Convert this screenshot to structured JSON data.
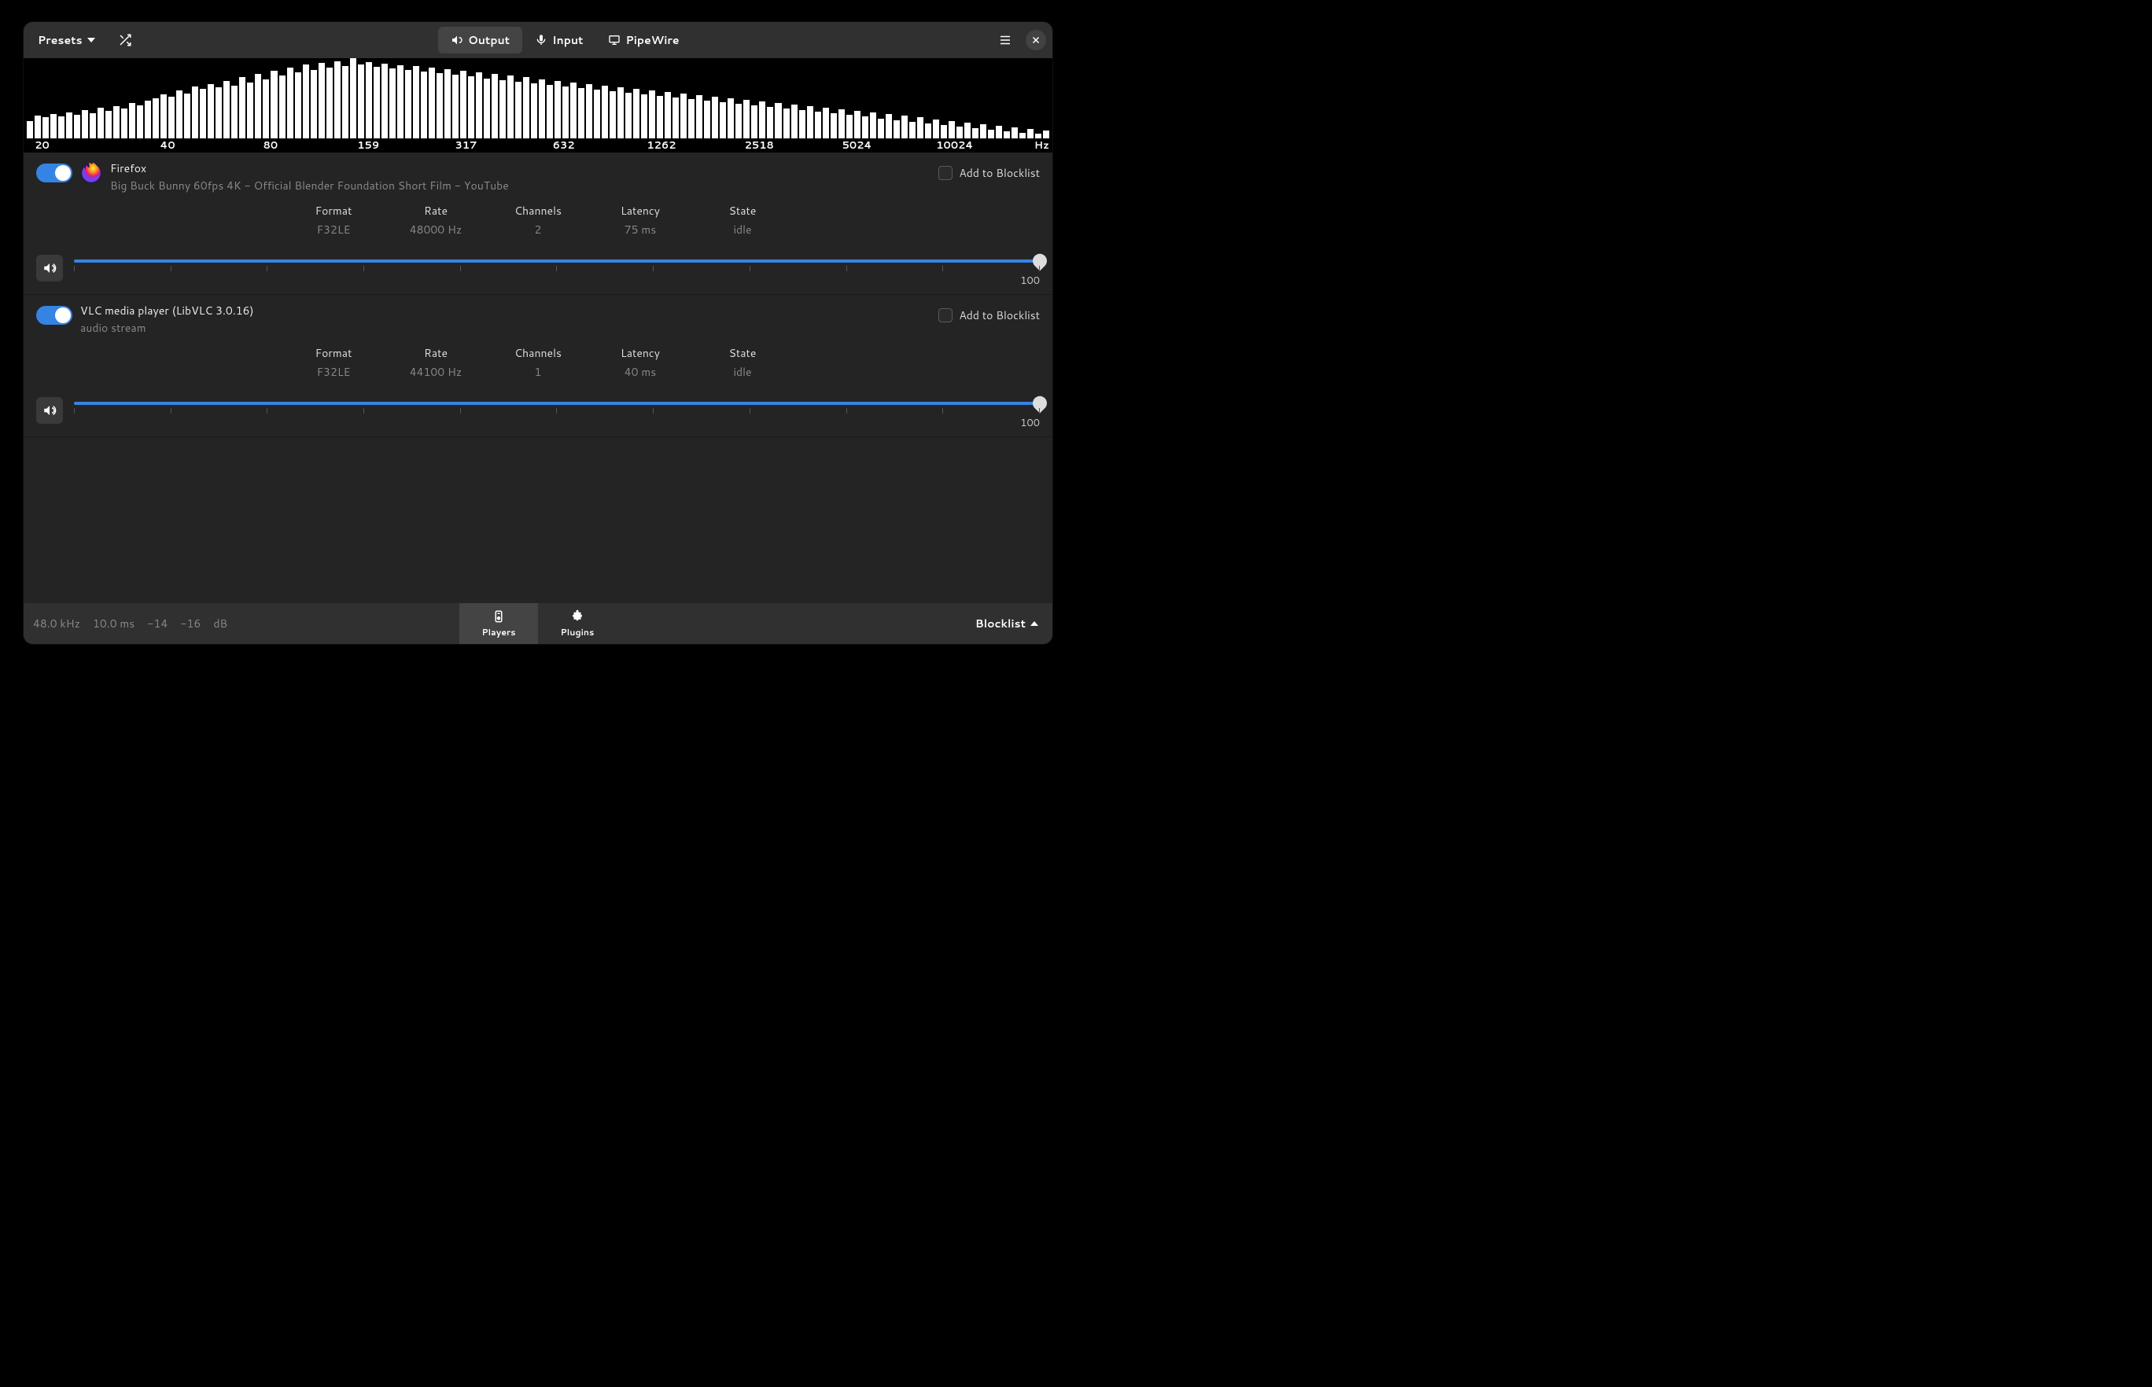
{
  "titlebar": {
    "presets_label": "Presets",
    "tabs": {
      "output": "Output",
      "input": "Input",
      "pipewire": "PipeWire"
    }
  },
  "spectrum": {
    "ticks": [
      "20",
      "40",
      "80",
      "159",
      "317",
      "632",
      "1262",
      "2518",
      "5024",
      "10024"
    ],
    "unit": "Hz"
  },
  "players": [
    {
      "name": "Firefox",
      "subtitle": "Big Buck Bunny 60fps 4K - Official Blender Foundation Short Film - YouTube",
      "enabled": true,
      "blocklist_label": "Add to Blocklist",
      "meta": {
        "format_label": "Format",
        "format_val": "F32LE",
        "rate_label": "Rate",
        "rate_val": "48000 Hz",
        "channels_label": "Channels",
        "channels_val": "2",
        "latency_label": "Latency",
        "latency_val": "75 ms",
        "state_label": "State",
        "state_val": "idle"
      },
      "volume": 100
    },
    {
      "name": "VLC media player (LibVLC 3.0.16)",
      "subtitle": "audio stream",
      "enabled": true,
      "blocklist_label": "Add to Blocklist",
      "meta": {
        "format_label": "Format",
        "format_val": "F32LE",
        "rate_label": "Rate",
        "rate_val": "44100 Hz",
        "channels_label": "Channels",
        "channels_val": "1",
        "latency_label": "Latency",
        "latency_val": "40 ms",
        "state_label": "State",
        "state_val": "idle"
      },
      "volume": 100
    }
  ],
  "statusbar": {
    "rate": "48.0 kHz",
    "latency": "10.0 ms",
    "level_l": "-14",
    "level_r": "-16",
    "db": "dB",
    "nav": {
      "players": "Players",
      "plugins": "Plugins"
    },
    "blocklist": "Blocklist"
  },
  "chart_data": {
    "type": "bar",
    "title": "",
    "xlabel": "Hz",
    "ylabel": "",
    "x_ticks": [
      20,
      40,
      80,
      159,
      317,
      632,
      1262,
      2518,
      5024,
      10024
    ],
    "values": [
      22,
      28,
      26,
      30,
      27,
      32,
      29,
      35,
      31,
      38,
      34,
      40,
      37,
      44,
      41,
      47,
      50,
      55,
      52,
      60,
      56,
      65,
      62,
      68,
      64,
      72,
      66,
      76,
      70,
      80,
      74,
      84,
      78,
      88,
      82,
      92,
      85,
      94,
      88,
      96,
      90,
      100,
      92,
      95,
      89,
      93,
      87,
      91,
      85,
      90,
      83,
      88,
      81,
      86,
      79,
      84,
      77,
      82,
      75,
      80,
      73,
      78,
      71,
      76,
      69,
      74,
      67,
      72,
      65,
      70,
      63,
      68,
      61,
      66,
      59,
      64,
      57,
      62,
      55,
      60,
      53,
      58,
      51,
      56,
      49,
      54,
      47,
      52,
      45,
      50,
      43,
      48,
      41,
      46,
      39,
      44,
      37,
      42,
      35,
      40,
      33,
      38,
      31,
      36,
      29,
      34,
      27,
      32,
      25,
      30,
      23,
      28,
      21,
      26,
      19,
      24,
      17,
      22,
      15,
      20,
      13,
      18,
      11,
      16,
      9,
      14,
      7,
      12,
      6,
      10
    ]
  }
}
